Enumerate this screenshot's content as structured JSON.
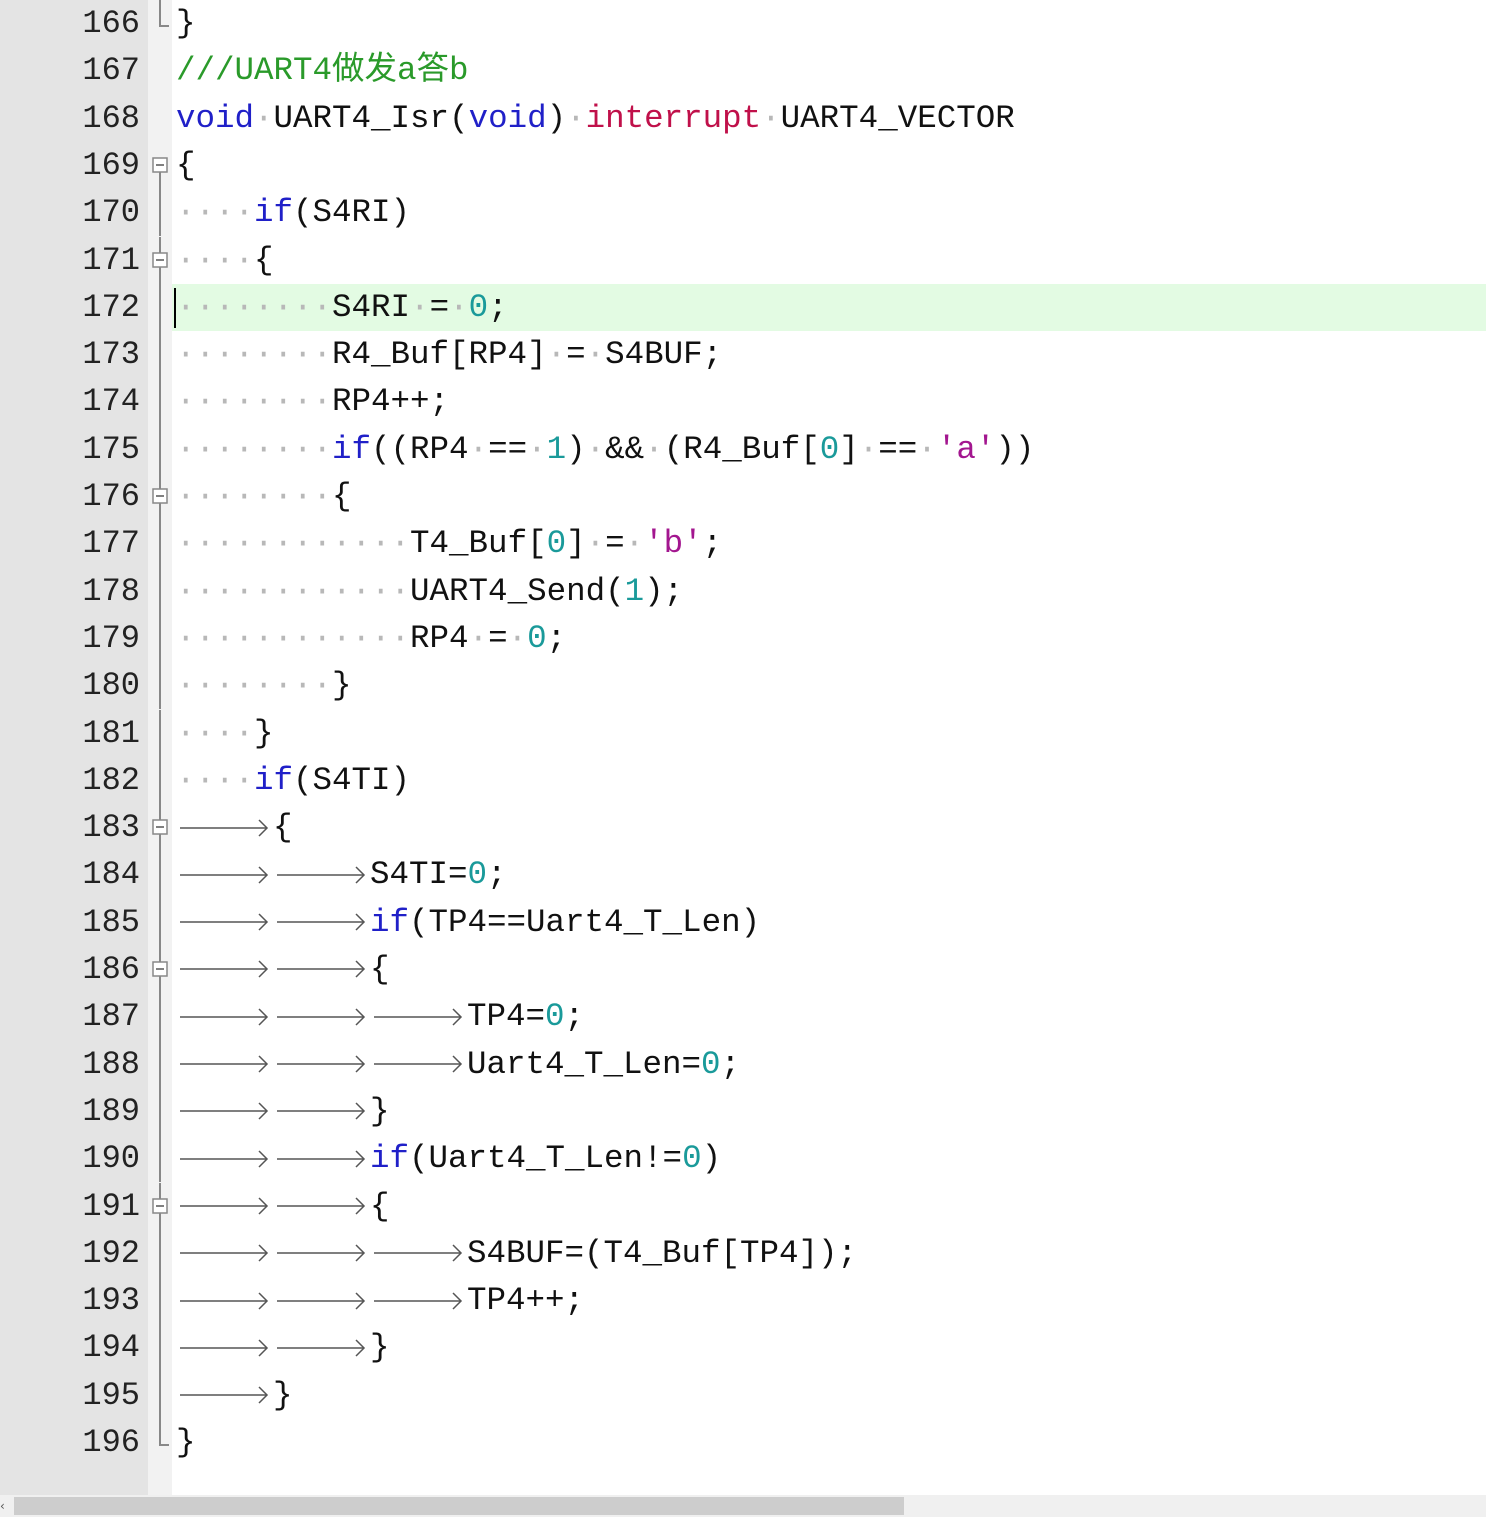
{
  "editor": {
    "current_line": 172,
    "lines": [
      {
        "num": "166",
        "tokens": [
          [
            "p",
            "}"
          ]
        ]
      },
      {
        "num": "167",
        "tokens": [
          [
            "c",
            "///UART4做发a答b"
          ]
        ]
      },
      {
        "num": "168",
        "tokens": [
          [
            "k",
            "void"
          ],
          [
            "d",
            "·"
          ],
          [
            "p",
            "UART4_Isr("
          ],
          [
            "k",
            "void"
          ],
          [
            "p",
            ")"
          ],
          [
            "d",
            "·"
          ],
          [
            "i",
            "interrupt"
          ],
          [
            "d",
            "·"
          ],
          [
            "p",
            "UART4_VECTOR"
          ]
        ]
      },
      {
        "num": "169",
        "tokens": [
          [
            "p",
            "{"
          ]
        ]
      },
      {
        "num": "170",
        "tokens": [
          [
            "d",
            "····"
          ],
          [
            "k",
            "if"
          ],
          [
            "p",
            "(S4RI)"
          ]
        ]
      },
      {
        "num": "171",
        "tokens": [
          [
            "d",
            "····"
          ],
          [
            "p",
            "{"
          ]
        ]
      },
      {
        "num": "172",
        "tokens": [
          [
            "d",
            "········"
          ],
          [
            "p",
            "S4RI"
          ],
          [
            "d",
            "·"
          ],
          [
            "p",
            "="
          ],
          [
            "d",
            "·"
          ],
          [
            "n",
            "0"
          ],
          [
            "p",
            ";"
          ]
        ]
      },
      {
        "num": "173",
        "tokens": [
          [
            "d",
            "········"
          ],
          [
            "p",
            "R4_Buf[RP4]"
          ],
          [
            "d",
            "·"
          ],
          [
            "p",
            "="
          ],
          [
            "d",
            "·"
          ],
          [
            "p",
            "S4BUF;"
          ]
        ]
      },
      {
        "num": "174",
        "tokens": [
          [
            "d",
            "········"
          ],
          [
            "p",
            "RP4++;"
          ]
        ]
      },
      {
        "num": "175",
        "tokens": [
          [
            "d",
            "········"
          ],
          [
            "k",
            "if"
          ],
          [
            "p",
            "((RP4"
          ],
          [
            "d",
            "·"
          ],
          [
            "p",
            "=="
          ],
          [
            "d",
            "·"
          ],
          [
            "n",
            "1"
          ],
          [
            "p",
            ")"
          ],
          [
            "d",
            "·"
          ],
          [
            "p",
            "&&"
          ],
          [
            "d",
            "·"
          ],
          [
            "p",
            "(R4_Buf["
          ],
          [
            "n",
            "0"
          ],
          [
            "p",
            "]"
          ],
          [
            "d",
            "·"
          ],
          [
            "p",
            "=="
          ],
          [
            "d",
            "·"
          ],
          [
            "s",
            "'a'"
          ],
          [
            "p",
            "))"
          ]
        ]
      },
      {
        "num": "176",
        "tokens": [
          [
            "d",
            "········"
          ],
          [
            "p",
            "{"
          ]
        ]
      },
      {
        "num": "177",
        "tokens": [
          [
            "d",
            "············"
          ],
          [
            "p",
            "T4_Buf["
          ],
          [
            "n",
            "0"
          ],
          [
            "p",
            "]"
          ],
          [
            "d",
            "·"
          ],
          [
            "p",
            "="
          ],
          [
            "d",
            "·"
          ],
          [
            "s",
            "'b'"
          ],
          [
            "p",
            ";"
          ]
        ]
      },
      {
        "num": "178",
        "tokens": [
          [
            "d",
            "············"
          ],
          [
            "p",
            "UART4_Send("
          ],
          [
            "n",
            "1"
          ],
          [
            "p",
            ");"
          ]
        ]
      },
      {
        "num": "179",
        "tokens": [
          [
            "d",
            "············"
          ],
          [
            "p",
            "RP4"
          ],
          [
            "d",
            "·"
          ],
          [
            "p",
            "="
          ],
          [
            "d",
            "·"
          ],
          [
            "n",
            "0"
          ],
          [
            "p",
            ";"
          ]
        ]
      },
      {
        "num": "180",
        "tokens": [
          [
            "d",
            "········"
          ],
          [
            "p",
            "}"
          ]
        ]
      },
      {
        "num": "181",
        "tokens": [
          [
            "d",
            "····"
          ],
          [
            "p",
            "}"
          ]
        ]
      },
      {
        "num": "182",
        "tokens": [
          [
            "d",
            "····"
          ],
          [
            "k",
            "if"
          ],
          [
            "p",
            "(S4TI)"
          ]
        ]
      },
      {
        "num": "183",
        "tokens": [
          [
            "t",
            ""
          ],
          [
            "p",
            "{"
          ]
        ]
      },
      {
        "num": "184",
        "tokens": [
          [
            "t",
            ""
          ],
          [
            "t",
            ""
          ],
          [
            "p",
            "S4TI="
          ],
          [
            "n",
            "0"
          ],
          [
            "p",
            ";"
          ]
        ]
      },
      {
        "num": "185",
        "tokens": [
          [
            "t",
            ""
          ],
          [
            "t",
            ""
          ],
          [
            "k",
            "if"
          ],
          [
            "p",
            "(TP4==Uart4_T_Len)"
          ]
        ]
      },
      {
        "num": "186",
        "tokens": [
          [
            "t",
            ""
          ],
          [
            "t",
            ""
          ],
          [
            "p",
            "{"
          ]
        ]
      },
      {
        "num": "187",
        "tokens": [
          [
            "t",
            ""
          ],
          [
            "t",
            ""
          ],
          [
            "t",
            ""
          ],
          [
            "p",
            "TP4="
          ],
          [
            "n",
            "0"
          ],
          [
            "p",
            ";"
          ]
        ]
      },
      {
        "num": "188",
        "tokens": [
          [
            "t",
            ""
          ],
          [
            "t",
            ""
          ],
          [
            "t",
            ""
          ],
          [
            "p",
            "Uart4_T_Len="
          ],
          [
            "n",
            "0"
          ],
          [
            "p",
            ";"
          ]
        ]
      },
      {
        "num": "189",
        "tokens": [
          [
            "t",
            ""
          ],
          [
            "t",
            ""
          ],
          [
            "p",
            "}"
          ]
        ]
      },
      {
        "num": "190",
        "tokens": [
          [
            "t",
            ""
          ],
          [
            "t",
            ""
          ],
          [
            "k",
            "if"
          ],
          [
            "p",
            "(Uart4_T_Len!="
          ],
          [
            "n",
            "0"
          ],
          [
            "p",
            ")"
          ]
        ]
      },
      {
        "num": "191",
        "tokens": [
          [
            "t",
            ""
          ],
          [
            "t",
            ""
          ],
          [
            "p",
            "{"
          ]
        ]
      },
      {
        "num": "192",
        "tokens": [
          [
            "t",
            ""
          ],
          [
            "t",
            ""
          ],
          [
            "t",
            ""
          ],
          [
            "p",
            "S4BUF=(T4_Buf[TP4]);"
          ]
        ]
      },
      {
        "num": "193",
        "tokens": [
          [
            "t",
            ""
          ],
          [
            "t",
            ""
          ],
          [
            "t",
            ""
          ],
          [
            "p",
            "TP4++;"
          ]
        ]
      },
      {
        "num": "194",
        "tokens": [
          [
            "t",
            ""
          ],
          [
            "t",
            ""
          ],
          [
            "p",
            "}"
          ]
        ]
      },
      {
        "num": "195",
        "tokens": [
          [
            "t",
            ""
          ],
          [
            "p",
            "}"
          ]
        ]
      },
      {
        "num": "196",
        "tokens": [
          [
            "p",
            "}"
          ]
        ]
      }
    ],
    "fold_markers": [
      "169",
      "171",
      "176",
      "183",
      "186",
      "191"
    ]
  },
  "scrollbar": {
    "left_arrow": "‹"
  },
  "colors": {
    "keyword": "#2020c8",
    "number": "#1a9a9a",
    "char": "#a3168f",
    "comment": "#2a9a2a",
    "interrupt": "#c0104a",
    "gutter": "#e4e4e4",
    "current_line_bg": "#e3fbe3"
  }
}
